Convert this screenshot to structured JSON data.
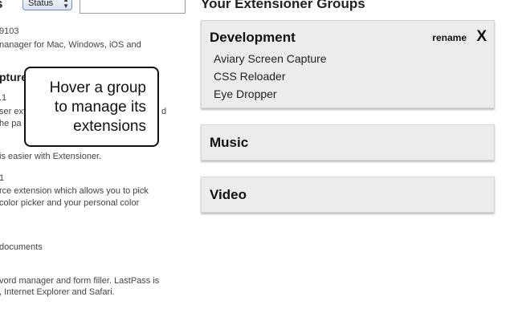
{
  "left_panel": {
    "title_fragment": "s",
    "status_select": {
      "selected": "Status"
    },
    "search": {
      "value": ""
    },
    "lines": [
      {
        "kind": "text",
        "text": "9103"
      },
      {
        "kind": "text",
        "text": "nanager for Mac, Windows, iOS and"
      },
      {
        "kind": "name",
        "text": "pture"
      },
      {
        "kind": "text",
        "text": ".1"
      },
      {
        "kind": "text",
        "text": "ser ext"
      },
      {
        "kind": "text",
        "text": "d"
      },
      {
        "kind": "text",
        "text": "he pa"
      },
      {
        "kind": "text",
        "text": "is easier with Extensioner."
      },
      {
        "kind": "text",
        "text": "1"
      },
      {
        "kind": "text",
        "text": "rce extension which allows you to pick"
      },
      {
        "kind": "text",
        "text": "color picker and your personal color"
      },
      {
        "kind": "text",
        "text": "documents"
      },
      {
        "kind": "text",
        "text": "vord manager and form filler. LastPass is"
      },
      {
        "kind": "text",
        "text": ", Internet Explorer and Safari."
      }
    ]
  },
  "tooltip": {
    "lines": [
      "Hover a group",
      "to manage its",
      "extensions"
    ]
  },
  "groups_panel": {
    "title": "Your Extensioner Groups",
    "groups": [
      {
        "name": "Development",
        "rename_label": "rename",
        "remove_label": "X",
        "extensions": [
          "Aviary Screen Capture",
          "CSS Reloader",
          "Eye Dropper"
        ]
      },
      {
        "name": "Music",
        "extensions": []
      },
      {
        "name": "Video",
        "extensions": []
      }
    ]
  }
}
